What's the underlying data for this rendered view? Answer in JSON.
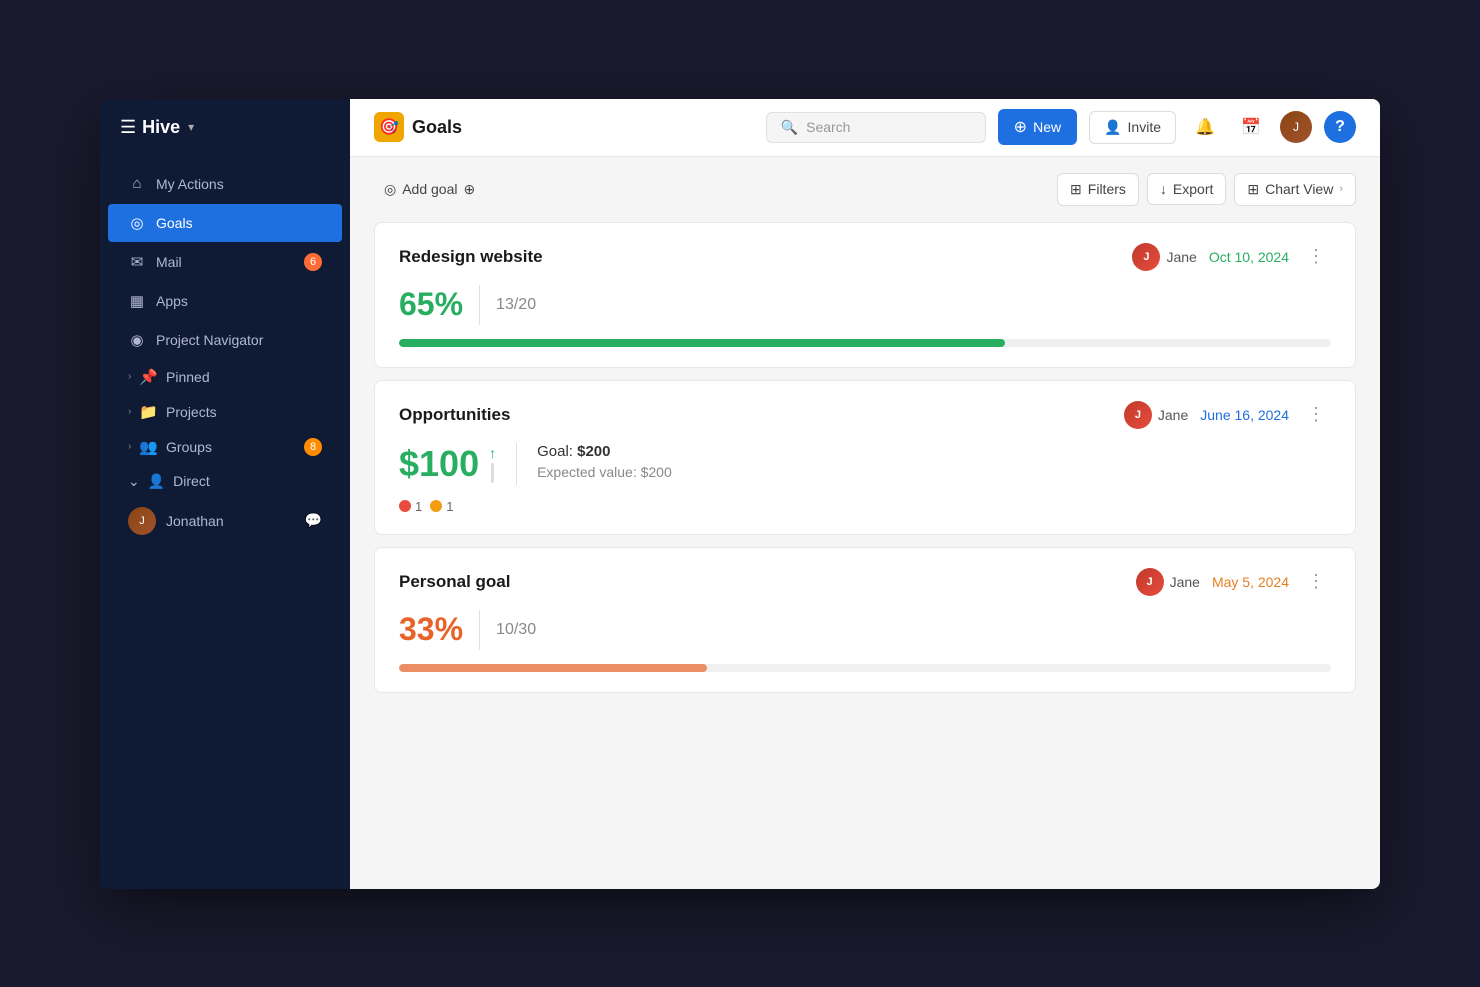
{
  "sidebar": {
    "brand": "Hive",
    "brand_icon": "☰",
    "dropdown_icon": "▾",
    "nav_items": [
      {
        "id": "my-actions",
        "label": "My Actions",
        "icon": "⌂",
        "active": false
      },
      {
        "id": "goals",
        "label": "Goals",
        "icon": "◎",
        "active": true
      },
      {
        "id": "mail",
        "label": "Mail",
        "icon": "✉",
        "badge": "6",
        "active": false
      },
      {
        "id": "apps",
        "label": "Apps",
        "icon": "▦",
        "active": false
      },
      {
        "id": "project-navigator",
        "label": "Project Navigator",
        "icon": "◉",
        "active": false
      }
    ],
    "section_items": [
      {
        "id": "pinned",
        "label": "Pinned",
        "icon": "📌"
      },
      {
        "id": "projects",
        "label": "Projects",
        "icon": "📁"
      },
      {
        "id": "groups",
        "label": "Groups",
        "icon": "👥",
        "badge": "8"
      }
    ],
    "direct_label": "Direct",
    "direct_users": [
      {
        "id": "jonathan",
        "label": "Jonathan",
        "has_message": true
      }
    ]
  },
  "topbar": {
    "page_icon": "🎯",
    "page_title": "Goals",
    "search_placeholder": "Search",
    "new_btn_label": "New",
    "invite_btn_label": "Invite",
    "bell_icon": "🔔",
    "calendar_icon": "📅",
    "help_label": "?"
  },
  "action_bar": {
    "add_goal_label": "Add goal",
    "add_icon": "⊕",
    "goal_icon": "◎",
    "filter_label": "Filters",
    "filter_icon": "⊞",
    "export_label": "Export",
    "export_icon": "↓",
    "chart_view_label": "Chart View",
    "chart_view_icon": "⊞",
    "chart_view_chevron": "›"
  },
  "goals": [
    {
      "id": "redesign-website",
      "title": "Redesign website",
      "assignee": "Jane",
      "date": "Oct 10, 2024",
      "date_color": "green",
      "percentage": "65%",
      "percentage_color": "green",
      "count": "13/20",
      "progress": 65,
      "progress_color": "green",
      "type": "progress"
    },
    {
      "id": "opportunities",
      "title": "Opportunities",
      "assignee": "Jane",
      "date": "June 16, 2024",
      "date_color": "blue",
      "amount": "$100",
      "goal_amount": "$200",
      "expected_label": "Expected value: $200",
      "status_dots": [
        {
          "color": "red",
          "count": "1"
        },
        {
          "color": "yellow",
          "count": "1"
        }
      ],
      "type": "currency"
    },
    {
      "id": "personal-goal",
      "title": "Personal goal",
      "assignee": "Jane",
      "date": "May 5, 2024",
      "date_color": "orange",
      "percentage": "33%",
      "percentage_color": "orange-red",
      "count": "10/30",
      "progress": 33,
      "progress_color": "orange-red",
      "type": "progress"
    }
  ]
}
